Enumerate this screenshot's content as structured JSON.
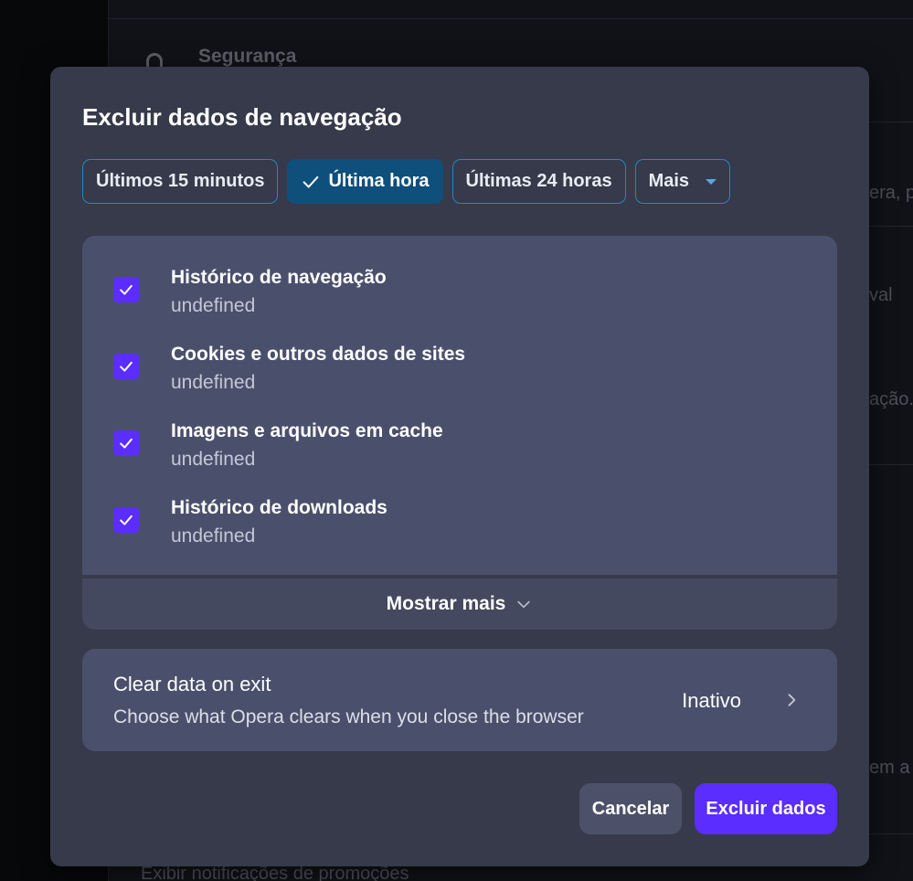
{
  "background": {
    "section_title": "Segurança",
    "fragments": [
      "era, p",
      "val",
      "ação.",
      "em a"
    ],
    "bottom_text": "Exibir notificações de promoções"
  },
  "dialog": {
    "title": "Excluir dados de navegação",
    "time_ranges": [
      {
        "label": "Últimos 15 minutos",
        "selected": false
      },
      {
        "label": "Última hora",
        "selected": true
      },
      {
        "label": "Últimas 24 horas",
        "selected": false
      },
      {
        "label": "Mais",
        "selected": false
      }
    ],
    "items": [
      {
        "label": "Histórico de navegação",
        "sub": "undefined",
        "checked": true
      },
      {
        "label": "Cookies e outros dados de sites",
        "sub": "undefined",
        "checked": true
      },
      {
        "label": "Imagens e arquivos em cache",
        "sub": "undefined",
        "checked": true
      },
      {
        "label": "Histórico de downloads",
        "sub": "undefined",
        "checked": true
      }
    ],
    "show_more": "Mostrar mais",
    "clear_on_exit": {
      "title": "Clear data on exit",
      "description": "Choose what Opera clears when you close the browser",
      "status": "Inativo"
    },
    "buttons": {
      "cancel": "Cancelar",
      "delete": "Excluir dados"
    }
  },
  "colors": {
    "accent": "#5b2dff",
    "chip_border": "#2489c0",
    "chip_selected": "#0f4f7c",
    "dialog_bg": "#363a4a",
    "panel_bg": "#4a506c"
  }
}
